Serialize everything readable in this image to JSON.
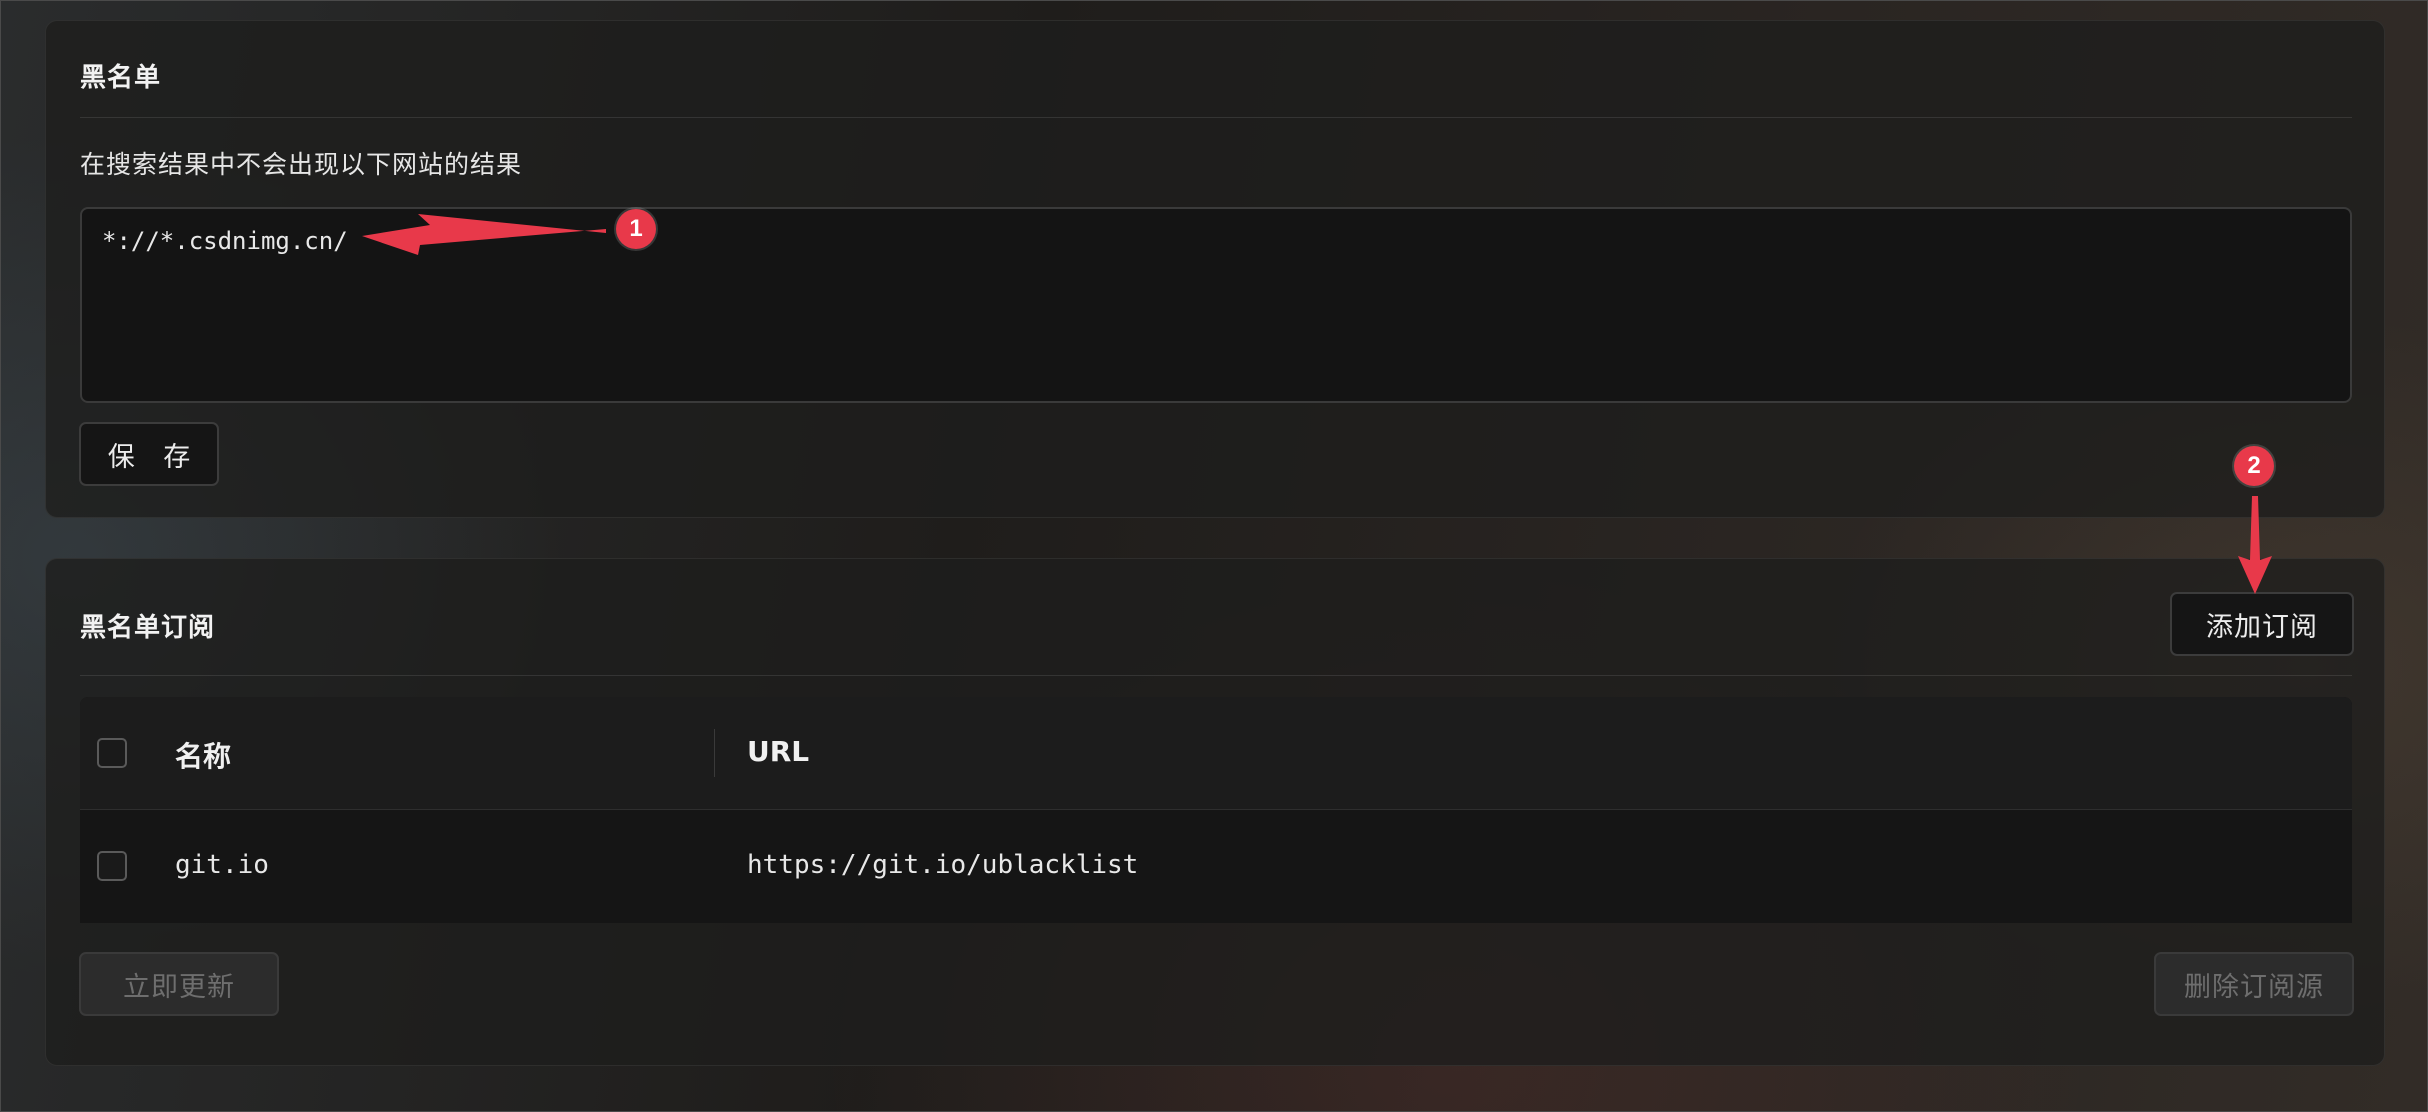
{
  "blacklist": {
    "title": "黑名单",
    "description": "在搜索结果中不会出现以下网站的结果",
    "rules_value": "*://*.csdnimg.cn/",
    "save_label": "保 存"
  },
  "subscription": {
    "title": "黑名单订阅",
    "add_label": "添加订阅",
    "columns": {
      "name": "名称",
      "url": "URL"
    },
    "rows": [
      {
        "name": "git.io",
        "url": "https://git.io/ublacklist"
      }
    ],
    "update_label": "立即更新",
    "delete_label": "删除订阅源"
  },
  "annotations": {
    "badge_1": "1",
    "badge_2": "2",
    "color": "#e8394a"
  }
}
